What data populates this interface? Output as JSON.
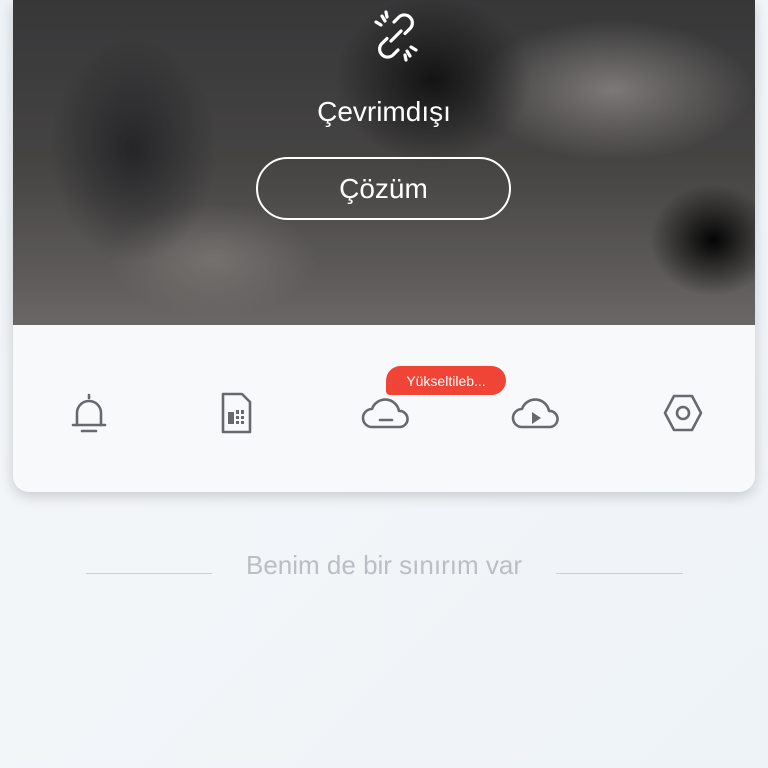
{
  "camera": {
    "status_text": "Çevrimdışı",
    "status_icon": "broken-link-icon",
    "solution_label": "Çözüm"
  },
  "toolbar": {
    "items": [
      {
        "icon": "bell-icon"
      },
      {
        "icon": "sim-card-icon"
      },
      {
        "icon": "cloud-icon",
        "badge": "Yükseltileb..."
      },
      {
        "icon": "cloud-play-icon"
      },
      {
        "icon": "settings-icon"
      }
    ],
    "badge_color": "#f04437"
  },
  "footer": {
    "text": "Benim de bir sınırım var"
  }
}
